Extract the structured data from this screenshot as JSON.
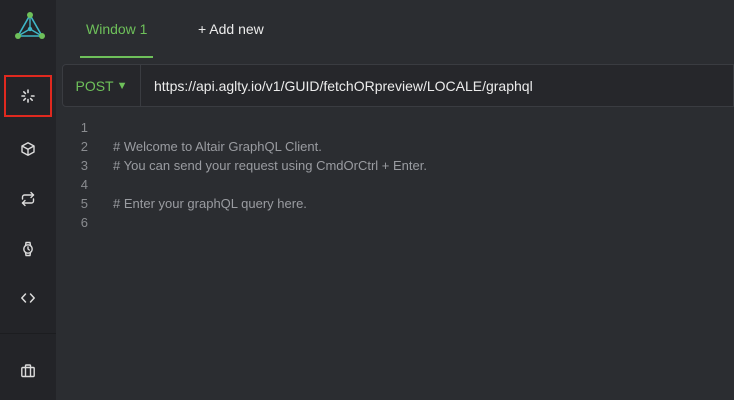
{
  "tabs": {
    "window_label": "Window 1",
    "add_label": "+ Add new"
  },
  "request": {
    "method": "POST",
    "method_caret": "▼",
    "url": "https://api.aglty.io/v1/GUID/fetchORpreview/LOCALE/graphql"
  },
  "editor": {
    "lines": [
      {
        "num": "1",
        "text": ""
      },
      {
        "num": "2",
        "text": "# Welcome to Altair GraphQL Client."
      },
      {
        "num": "3",
        "text": "# You can send your request using CmdOrCtrl + Enter."
      },
      {
        "num": "4",
        "text": ""
      },
      {
        "num": "5",
        "text": "# Enter your graphQL query here."
      },
      {
        "num": "6",
        "text": ""
      }
    ]
  },
  "sidebar": {
    "items": [
      {
        "icon": "loading-icon",
        "active": true
      },
      {
        "icon": "cube-icon"
      },
      {
        "icon": "swap-arrows-icon"
      },
      {
        "icon": "watch-icon"
      },
      {
        "icon": "code-brackets-icon"
      },
      {
        "icon": "briefcase-icon"
      }
    ]
  },
  "colors": {
    "accent_green": "#6ec05a",
    "highlight_red": "#e0291f",
    "logo_teal": "#3fb6c6"
  }
}
